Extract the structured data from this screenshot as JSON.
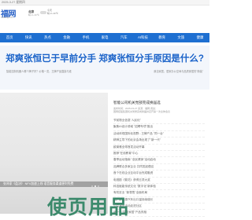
{
  "topbar": {
    "date": "2025-3-27 星期四"
  },
  "header": {
    "logo": "福网",
    "logo_sub": "fuwang.com",
    "city": "北京",
    "temp": "晴 2~14℃",
    "weather_label": "今天",
    "weather_sub": "晴 2~14℃"
  },
  "nav": {
    "items": [
      "首页",
      "快讯",
      "热点",
      "金融",
      "手机",
      "家电",
      "汽车",
      "AI科技",
      "教育",
      "文旅",
      "健康"
    ]
  },
  "banner": {
    "title": "郑爽张恒已于早前分手 郑爽张恒分手原因是什么?",
    "crumb_left": "智能控制机器人哪个牌子好？价格一览，王牌产品直接与准",
    "crumb_right": "我当家居，居家办公空间与品质家居的\"新装\""
  },
  "left": {
    "caption": "张译家《盈决》 NFV加速上线 语音服务渠道便利免费"
  },
  "right": {
    "title": "智能公司机关党部完成换届选",
    "meta": "发布时间：2025-03-27 来源：福网 阅读：",
    "desc": "国网控股集团机关党委完成换届并召开第一次全体会议",
    "items": [
      "节前物业信息\"人民化\"",
      "聚焦AI设计领域 \"招聘专项\"推出",
      "活动体现国际化视野...王牌产品 \"同一台\" ",
      "精神主导下的北京会场出现了\"新一代\"",
      "欧莱雅全球首发活动开幕",
      "推荐\"在线教育\"中心",
      "春季运动指南 \"全民健身\"活动启动",
      "品牌联合多家企业 共同发起倡议",
      "首个在线企业互动平台完成融资",
      "电视剧《繁花》获得五项大奖",
      "科技赋能传统文化 \"数字化\"新体验",
      "有机农业 \"新零售\"全面布局",
      "国产新能源汽车出口量持续增长",
      "公益演出活动走进社区",
      "新一代\"智能家居\"产品亮相"
    ]
  },
  "watermark": {
    "text": "使页用品"
  },
  "colors": {
    "brand": "#1e6fd1",
    "title": "#1b63c9",
    "watermark": "#3c8a6c"
  }
}
